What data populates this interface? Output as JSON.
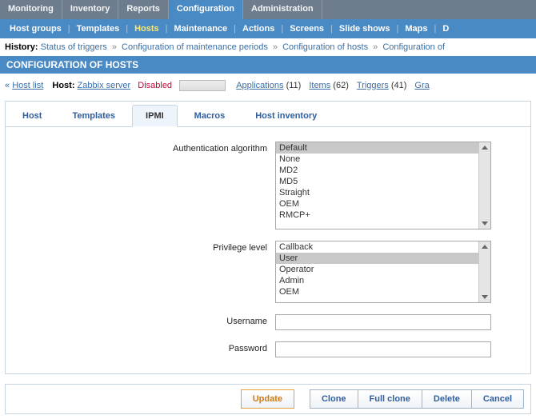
{
  "topnav": {
    "items": [
      "Monitoring",
      "Inventory",
      "Reports",
      "Configuration",
      "Administration"
    ],
    "active_index": 3
  },
  "subnav": {
    "items": [
      "Host groups",
      "Templates",
      "Hosts",
      "Maintenance",
      "Actions",
      "Screens",
      "Slide shows",
      "Maps",
      "D"
    ],
    "active_index": 2
  },
  "history": {
    "label": "History:",
    "items": [
      "Status of triggers",
      "Configuration of maintenance periods",
      "Configuration of hosts",
      "Configuration of"
    ]
  },
  "page_title": "CONFIGURATION OF HOSTS",
  "toolbar": {
    "hostlist_label": "Host list",
    "host_label": "Host:",
    "host_name": "Zabbix server",
    "status": "Disabled",
    "links": [
      {
        "label": "Applications",
        "count": "(11)"
      },
      {
        "label": "Items",
        "count": "(62)"
      },
      {
        "label": "Triggers",
        "count": "(41)"
      },
      {
        "label": "Gra",
        "count": ""
      }
    ]
  },
  "tabs": {
    "items": [
      "Host",
      "Templates",
      "IPMI",
      "Macros",
      "Host inventory"
    ],
    "active_index": 2
  },
  "form": {
    "auth": {
      "label": "Authentication algorithm",
      "options": [
        "Default",
        "None",
        "MD2",
        "MD5",
        "Straight",
        "OEM",
        "RMCP+"
      ],
      "selected": "Default"
    },
    "priv": {
      "label": "Privilege level",
      "options": [
        "Callback",
        "User",
        "Operator",
        "Admin",
        "OEM"
      ],
      "selected": "User"
    },
    "username": {
      "label": "Username",
      "value": ""
    },
    "password": {
      "label": "Password",
      "value": ""
    }
  },
  "buttons": {
    "update": "Update",
    "clone": "Clone",
    "full_clone": "Full clone",
    "delete": "Delete",
    "cancel": "Cancel"
  }
}
